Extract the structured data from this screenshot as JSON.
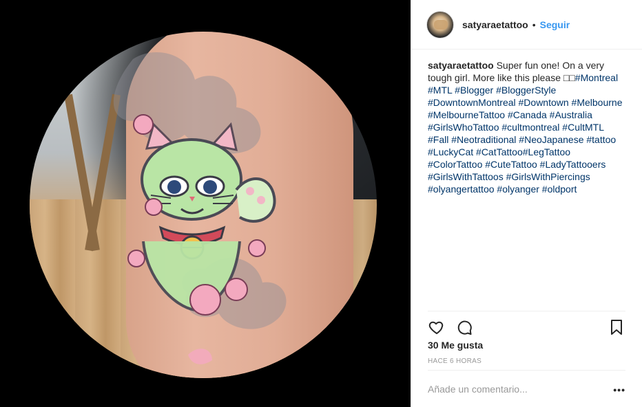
{
  "post": {
    "author": {
      "username": "satyaraetattoo",
      "follow_label": "Seguir",
      "separator": "•"
    },
    "caption": {
      "username": "satyaraetattoo",
      "text": "Super fun one! On a very tough girl. More like this please □□",
      "hashtags": "#Montreal #MTL #Blogger #BloggerStyle #DowntownMontreal #Downtown #Melbourne #MelbourneTattoo #Canada #Australia #GirlsWhoTattoo #cultmontreal #CultMTL #Fall #Neotraditional #NeoJapanese #tattoo #LuckyCat #CatTattoo#LegTattoo #ColorTattoo #CuteTattoo #LadyTattooers #GirlsWithTattoos #GirlsWithPiercings #olyangertattoo #olyanger #oldport"
    },
    "likes_text": "30 Me gusta",
    "time_text": "HACE 6 HORAS",
    "comment": {
      "placeholder": "Añade un comentario...",
      "value": ""
    },
    "more_label": "•••",
    "icons": {
      "like": "heart-icon",
      "comment": "comment-icon",
      "save": "bookmark-icon"
    }
  },
  "colors": {
    "link": "#3897f0",
    "hashtag": "#003569",
    "muted": "#999999",
    "text": "#262626"
  }
}
